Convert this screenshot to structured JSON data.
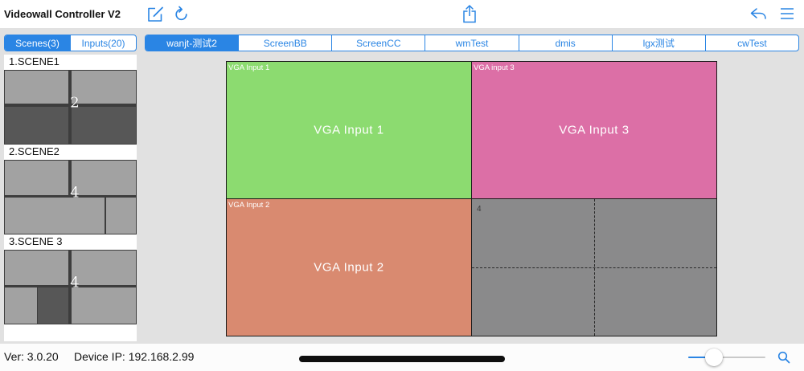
{
  "app": {
    "title": "Videowall Controller V2"
  },
  "colors": {
    "accent": "#2a85e4",
    "background": "#e1e1e1",
    "thumb_light": "#a2a2a2",
    "thumb_dark": "#575757",
    "empty_window": "#8a8a8b"
  },
  "icons": {
    "edit": "compose-icon",
    "refresh": "refresh-icon",
    "share": "share-icon",
    "undo": "reply-icon",
    "menu": "menu-icon",
    "search": "search-icon"
  },
  "sidebar_tabs": [
    {
      "label": "Scenes(3)",
      "selected": true
    },
    {
      "label": "Inputs(20)",
      "selected": false
    }
  ],
  "screen_tabs": [
    {
      "label": "wanjt-测试2",
      "selected": true
    },
    {
      "label": "ScreenBB",
      "selected": false
    },
    {
      "label": "ScreenCC",
      "selected": false
    },
    {
      "label": "wmTest",
      "selected": false
    },
    {
      "label": "dmis",
      "selected": false
    },
    {
      "label": "lgx测试",
      "selected": false
    },
    {
      "label": "cwTest",
      "selected": false
    }
  ],
  "scenes": [
    {
      "label": "1.SCENE1",
      "window_count": "2"
    },
    {
      "label": "2.SCENE2",
      "window_count": "4"
    },
    {
      "label": "3.SCENE 3",
      "window_count": "4"
    }
  ],
  "wall": {
    "windows": [
      {
        "tag": "VGA Input 1",
        "title": "VGA Input 1",
        "color": "#8cdb70"
      },
      {
        "tag": "VGA input 3",
        "title": "VGA Input 3",
        "color": "#dc6fa6"
      },
      {
        "tag": "VGA Input 2",
        "title": "VGA Input 2",
        "color": "#d98a70"
      }
    ],
    "empty_window": {
      "tag": "4"
    }
  },
  "footer": {
    "version": "Ver: 3.0.20",
    "device_ip": "Device IP: 192.168.2.99",
    "zoom_level": 0.33
  }
}
